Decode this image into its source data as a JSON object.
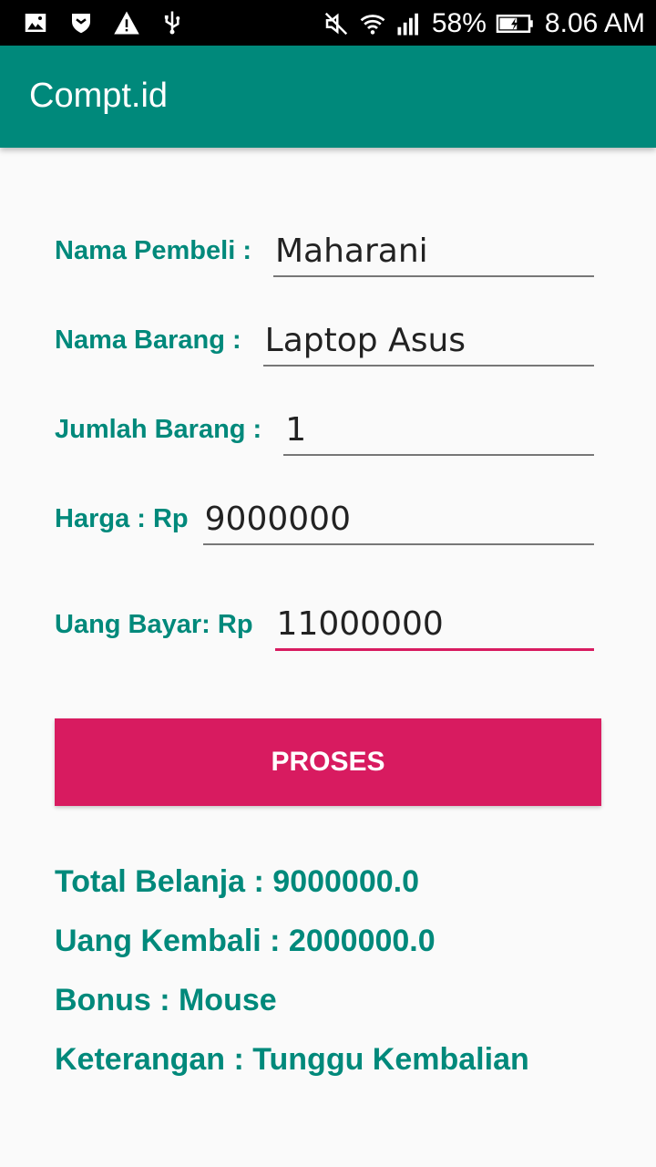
{
  "status_bar": {
    "battery": "58%",
    "time": "8.06 AM",
    "icons_left": [
      "image-icon",
      "shield-icon",
      "warning-icon",
      "usb-icon"
    ],
    "icons_right": [
      "mute-icon",
      "wifi-icon",
      "signal-icon",
      "battery-icon"
    ]
  },
  "app_bar": {
    "title": "Compt.id"
  },
  "form": {
    "nama_pembeli": {
      "label": "Nama Pembeli :",
      "value": "Maharani"
    },
    "nama_barang": {
      "label": "Nama Barang :",
      "value": "Laptop Asus"
    },
    "jumlah_barang": {
      "label": "Jumlah Barang :",
      "value": "1"
    },
    "harga": {
      "label": "Harga : Rp",
      "value": "9000000"
    },
    "uang_bayar": {
      "label": "Uang Bayar: Rp",
      "value": "11000000"
    }
  },
  "button": {
    "label": "PROSES"
  },
  "results": {
    "total_belanja": "Total Belanja : 9000000.0",
    "uang_kembali": "Uang Kembali : 2000000.0",
    "bonus": "Bonus : Mouse",
    "keterangan": "Keterangan : Tunggu Kembalian"
  },
  "colors": {
    "primary": "#00897b",
    "accent": "#d81b60",
    "background": "#fafafa",
    "status_bar": "#000000"
  }
}
